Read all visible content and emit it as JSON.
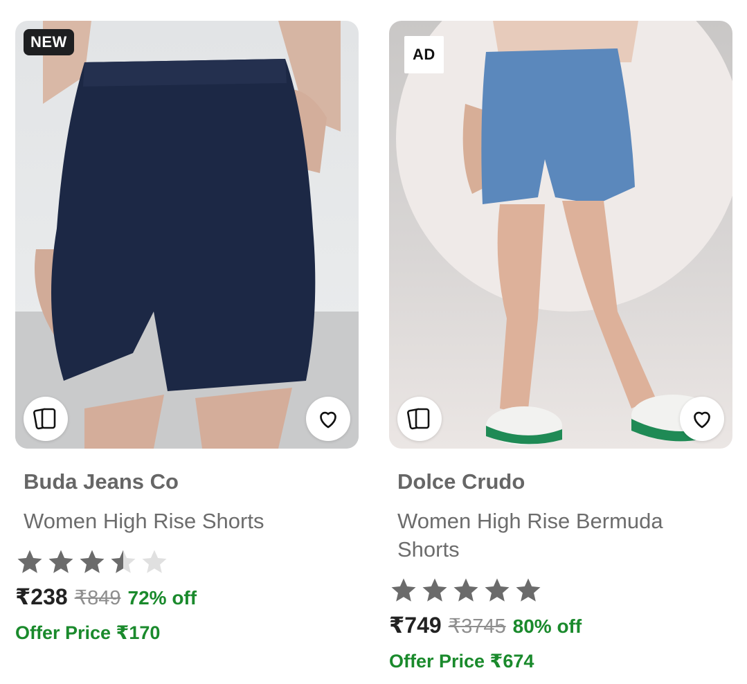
{
  "products": [
    {
      "badge": "NEW",
      "brand": "Buda Jeans Co",
      "title": "Women High Rise Shorts",
      "rating": 3.5,
      "price": "₹238",
      "mrp": "₹849",
      "discount": "72% off",
      "offer_price": "Offer Price ₹170",
      "icons": {
        "similar": "similar-cards-icon",
        "wishlist": "heart-icon"
      }
    },
    {
      "badge": "AD",
      "brand": "Dolce Crudo",
      "title": "Women High Rise Bermuda Shorts",
      "rating": 5,
      "price": "₹749",
      "mrp": "₹3745",
      "discount": "80% off",
      "offer_price": "Offer Price ₹674",
      "icons": {
        "similar": "similar-cards-icon",
        "wishlist": "heart-icon"
      }
    }
  ],
  "colors": {
    "star_filled": "#6b6b6b",
    "star_empty": "#e0e0e0",
    "discount_green": "#1a8a2c"
  }
}
